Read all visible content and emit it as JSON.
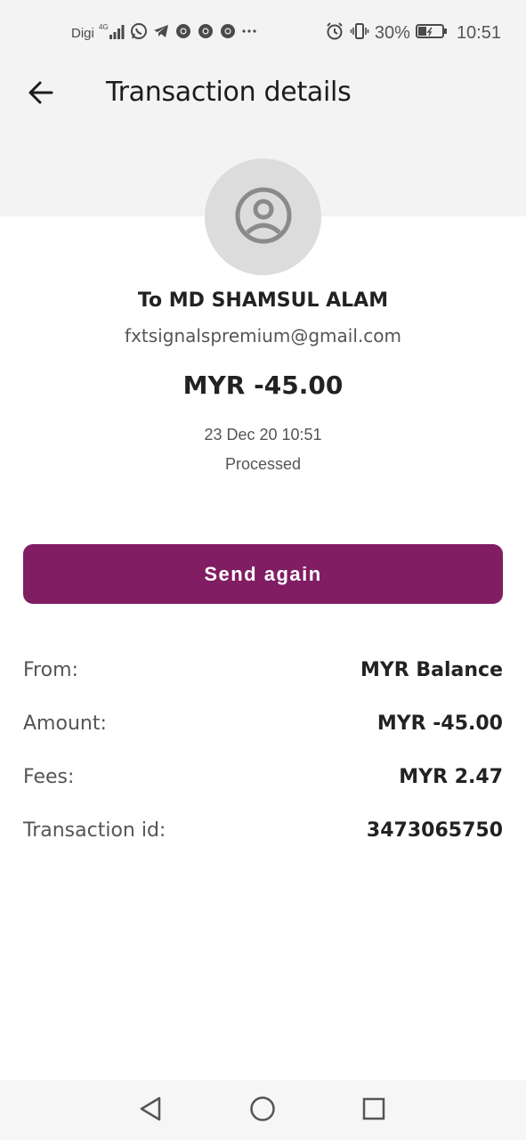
{
  "status_bar": {
    "carrier": "Digi",
    "network": "4G",
    "battery_percent": "30%",
    "time": "10:51",
    "notification_icons": [
      "whatsapp-icon",
      "telegram-icon",
      "chrome-icon",
      "chrome-icon",
      "chrome-icon",
      "more-icon"
    ],
    "system_icons": [
      "alarm-icon",
      "vibrate-icon",
      "battery-icon"
    ]
  },
  "header": {
    "title": "Transaction details",
    "back_icon": "arrow-left-icon"
  },
  "recipient": {
    "name": "To MD SHAMSUL ALAM",
    "email": "fxtsignalspremium@gmail.com",
    "avatar_icon": "user-circle-icon"
  },
  "transaction": {
    "amount": "MYR -45.00",
    "datetime": "23 Dec 20 10:51",
    "status": "Processed"
  },
  "actions": {
    "send_again_label": "Send again"
  },
  "details": [
    {
      "label": "From:",
      "value": "MYR Balance"
    },
    {
      "label": "Amount:",
      "value": "MYR -45.00"
    },
    {
      "label": "Fees:",
      "value": "MYR 2.47"
    },
    {
      "label": "Transaction id:",
      "value": "3473065750"
    }
  ],
  "colors": {
    "primary": "#801d63",
    "header_bg": "#f3f3f3",
    "avatar_bg": "#dcdcdc"
  },
  "nav_bar": [
    "back-triangle-icon",
    "home-circle-icon",
    "recents-square-icon"
  ]
}
